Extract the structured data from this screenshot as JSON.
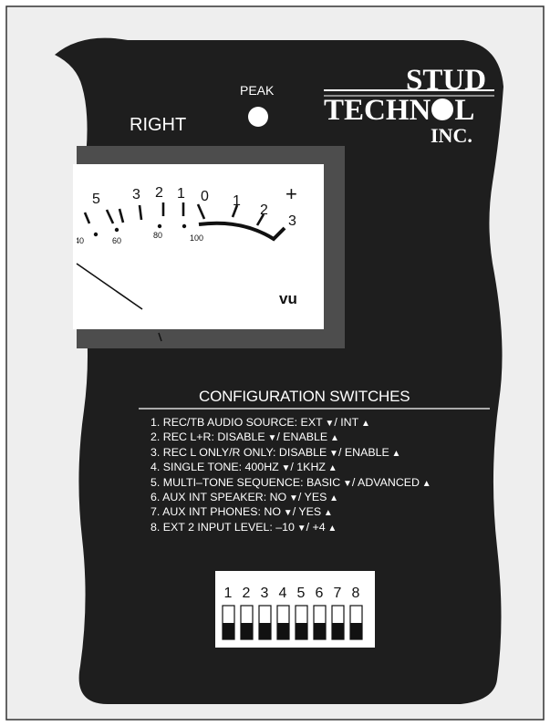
{
  "panel": {
    "right_label": "RIGHT",
    "peak_label": "PEAK"
  },
  "logo": {
    "line1": "STUD",
    "line2": "TECHN",
    "line2_tail": "L",
    "line3": "INC."
  },
  "meter": {
    "db_scale": [
      "5",
      "3",
      "2",
      "1",
      "0",
      "1",
      "2",
      "3"
    ],
    "plus_sign": "+",
    "percent_scale": [
      "40",
      "60",
      "80",
      "100"
    ],
    "unit_label": "VU"
  },
  "config": {
    "title": "CONFIGURATION SWITCHES",
    "items": [
      {
        "text": "1. REC/TB AUDIO SOURCE: EXT",
        "off": "/ INT",
        "on": ""
      },
      {
        "text": "2. REC L+R: DISABLE",
        "off": "/ ENABLE",
        "on": ""
      },
      {
        "text": "3. REC L ONLY/R ONLY: DISABLE",
        "off": "/ ENABLE",
        "on": ""
      },
      {
        "text": "4. SINGLE TONE: 400HZ",
        "off": "/ 1KHZ",
        "on": ""
      },
      {
        "text": "5. MULTI–TONE SEQUENCE: BASIC",
        "off": "/ ADVANCED",
        "on": ""
      },
      {
        "text": "6. AUX INT SPEAKER: NO",
        "off": "/ YES",
        "on": ""
      },
      {
        "text": "7. AUX INT PHONES: NO",
        "off": "/ YES",
        "on": ""
      },
      {
        "text": "8. EXT 2 INPUT LEVEL: –10",
        "off": "/ +4",
        "on": ""
      }
    ],
    "switch_numbers": [
      "1",
      "2",
      "3",
      "4",
      "5",
      "6",
      "7",
      "8"
    ]
  },
  "colors": {
    "panel": "#1e1e1e",
    "bezel": "#4d4d4d",
    "face": "#ffffff",
    "frame": "#eeeeee"
  }
}
